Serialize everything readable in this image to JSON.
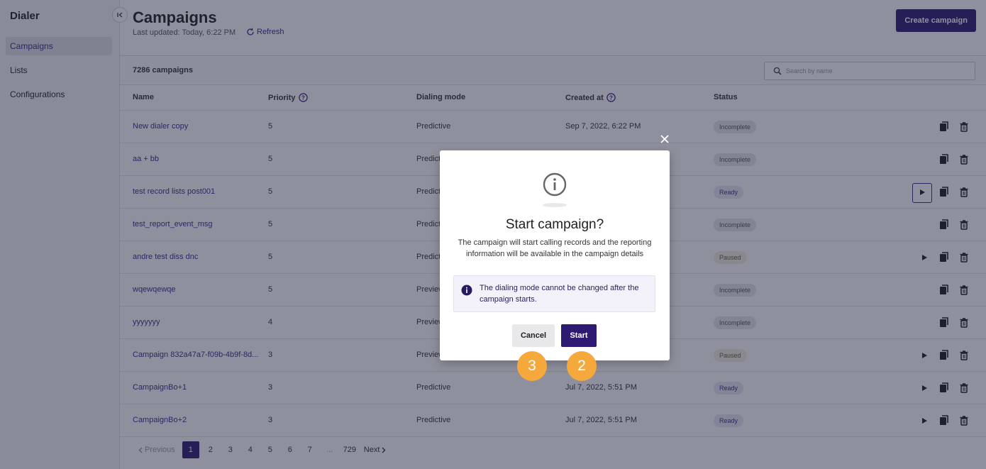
{
  "sidebar": {
    "app_title": "Dialer",
    "items": [
      {
        "label": "Campaigns"
      },
      {
        "label": "Lists"
      },
      {
        "label": "Configurations"
      }
    ]
  },
  "header": {
    "title": "Campaigns",
    "last_updated": "Last updated: Today, 6:22 PM",
    "refresh_label": "Refresh",
    "create_label": "Create campaign"
  },
  "toolbar": {
    "count": "7286 campaigns",
    "search_placeholder": "Search by name"
  },
  "table": {
    "headers": {
      "name": "Name",
      "priority": "Priority",
      "mode": "Dialing mode",
      "created": "Created at",
      "status": "Status"
    },
    "rows": [
      {
        "name": "New dialer copy",
        "priority": "5",
        "mode": "Predictive",
        "created": "Sep 7, 2022, 6:22 PM",
        "status": "Incomplete"
      },
      {
        "name": "aa + bb",
        "priority": "5",
        "mode": "Predictive",
        "created": "",
        "status": "Incomplete"
      },
      {
        "name": "test record lists post001",
        "priority": "5",
        "mode": "Predictive",
        "created": "",
        "status": "Ready"
      },
      {
        "name": "test_report_event_msg",
        "priority": "5",
        "mode": "Predictive",
        "created": "",
        "status": "Incomplete"
      },
      {
        "name": "andre test diss dnc",
        "priority": "5",
        "mode": "Predictive",
        "created": "",
        "status": "Paused"
      },
      {
        "name": "wqewqewqe",
        "priority": "5",
        "mode": "Preview",
        "created": "",
        "status": "Incomplete"
      },
      {
        "name": "yyyyyyy",
        "priority": "4",
        "mode": "Preview",
        "created": "",
        "status": "Incomplete"
      },
      {
        "name": "Campaign 832a47a7-f09b-4b9f-8d...",
        "priority": "3",
        "mode": "Preview",
        "created": "",
        "status": "Paused"
      },
      {
        "name": "CampaignBo+1",
        "priority": "3",
        "mode": "Predictive",
        "created": "Jul 7, 2022, 5:51 PM",
        "status": "Ready"
      },
      {
        "name": "CampaignBo+2",
        "priority": "3",
        "mode": "Predictive",
        "created": "Jul 7, 2022, 5:51 PM",
        "status": "Ready"
      }
    ]
  },
  "pagination": {
    "previous": "Previous",
    "pages": [
      "1",
      "2",
      "3",
      "4",
      "5",
      "6",
      "7",
      "...",
      "729"
    ],
    "next": "Next"
  },
  "modal": {
    "title": "Start campaign?",
    "body": "The campaign will start calling records and the reporting information will be available in the campaign details",
    "alert": "The dialing mode cannot be changed after the campaign starts.",
    "cancel_label": "Cancel",
    "start_label": "Start"
  },
  "steps": {
    "cancel_step": "3",
    "start_step": "2"
  },
  "colors": {
    "brand": "#2f1a73",
    "link": "#3a2a8c",
    "step": "#f5a93c"
  }
}
